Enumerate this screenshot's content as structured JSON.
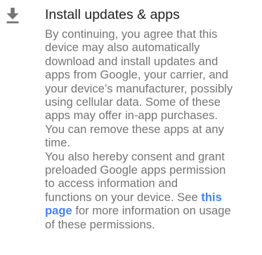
{
  "setting": {
    "icon": "download-icon",
    "title": "Install updates & apps",
    "description_lines": [
      "By continuing, you agree that this",
      "device may also automatically",
      "download and install updates and",
      "apps from Google, your carrier, and",
      "your device’s manufacturer, possibly",
      "using cellular data. Some of these",
      "apps may offer in-app purchases.",
      "You can remove these apps at any",
      "time.",
      "You also hereby consent and grant",
      "preloaded Google apps permission",
      "to access information and"
    ],
    "permissions_sentence": {
      "before_link": "functions on your device. See ",
      "link_first_word": "this",
      "link_second_word": "page",
      "after_link": " for more information on usage",
      "final_line": "of these permissions."
    }
  },
  "colors": {
    "title": "#212121",
    "body_text": "#757575",
    "link": "#4285f4",
    "icon": "#757575"
  }
}
